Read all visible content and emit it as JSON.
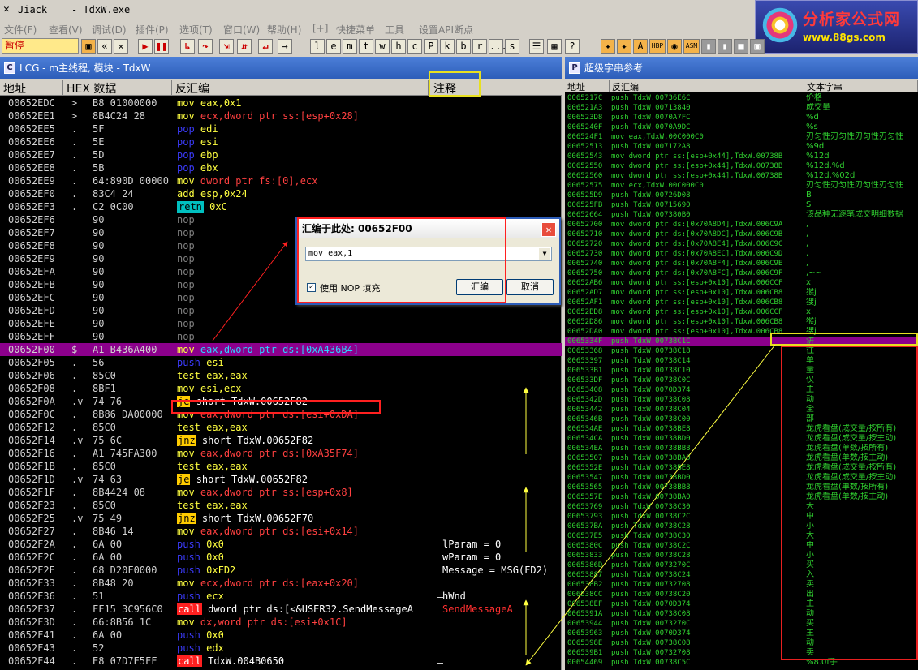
{
  "window": {
    "title_app": "Jiack",
    "title_exe": "- TdxW.exe"
  },
  "logo": {
    "line1": "分析家公式网",
    "line2": "www.88gs.com"
  },
  "menu": [
    "文件(F)",
    "查看(V)",
    "调试(D)",
    "插件(P)",
    "选项(T)",
    "窗口(W)",
    "帮助(H)",
    "[+]",
    "快捷菜单",
    "工具",
    "设置API断点"
  ],
  "toolbar": {
    "status": "暂停",
    "letters": [
      "l",
      "e",
      "m",
      "t",
      "w",
      "h",
      "c",
      "P",
      "k",
      "b",
      "r",
      "...",
      "s"
    ],
    "hbp": "HBP",
    "asm": "ASM"
  },
  "left_pane": {
    "title": "LCG - m主线程, 模块 - TdxW",
    "headers": {
      "addr": "地址",
      "hex": "HEX 数据",
      "disasm": "反汇编",
      "comment": "注释"
    },
    "rows": [
      {
        "addr": "00652EDC",
        "mark": ">",
        "hex": "B8 01000000",
        "k": "mov",
        "kc": "k-mov",
        "ops": "eax,0x1"
      },
      {
        "addr": "00652EE1",
        "mark": ">",
        "hex": "8B4C24 28",
        "k": "mov",
        "kc": "k-mov",
        "ops": "ecx,dword ptr ss:[esp+0x28]"
      },
      {
        "addr": "00652EE5",
        "mark": ".",
        "hex": "5F",
        "k": "pop",
        "kc": "k-pop",
        "ops": "edi"
      },
      {
        "addr": "00652EE6",
        "mark": ".",
        "hex": "5E",
        "k": "pop",
        "kc": "k-pop",
        "ops": "esi"
      },
      {
        "addr": "00652EE7",
        "mark": ".",
        "hex": "5D",
        "k": "pop",
        "kc": "k-pop",
        "ops": "ebp"
      },
      {
        "addr": "00652EE8",
        "mark": ".",
        "hex": "5B",
        "k": "pop",
        "kc": "k-pop",
        "ops": "ebx"
      },
      {
        "addr": "00652EE9",
        "mark": ".",
        "hex": "64:890D 00000",
        "k": "mov",
        "kc": "k-mov",
        "ops": "dword ptr fs:[0],ecx"
      },
      {
        "addr": "00652EF0",
        "mark": ".",
        "hex": "83C4 24",
        "k": "add",
        "kc": "k-add",
        "ops": "esp,0x24"
      },
      {
        "addr": "00652EF3",
        "mark": ".",
        "hex": "C2 0C00",
        "k": "retn",
        "kc": "k-retn",
        "ops": "0xC"
      },
      {
        "addr": "00652EF6",
        "mark": "",
        "hex": "90",
        "k": "nop",
        "kc": "k-nop",
        "ops": ""
      },
      {
        "addr": "00652EF7",
        "mark": "",
        "hex": "90",
        "k": "nop",
        "kc": "k-nop",
        "ops": ""
      },
      {
        "addr": "00652EF8",
        "mark": "",
        "hex": "90",
        "k": "nop",
        "kc": "k-nop",
        "ops": ""
      },
      {
        "addr": "00652EF9",
        "mark": "",
        "hex": "90",
        "k": "nop",
        "kc": "k-nop",
        "ops": ""
      },
      {
        "addr": "00652EFA",
        "mark": "",
        "hex": "90",
        "k": "nop",
        "kc": "k-nop",
        "ops": ""
      },
      {
        "addr": "00652EFB",
        "mark": "",
        "hex": "90",
        "k": "nop",
        "kc": "k-nop",
        "ops": ""
      },
      {
        "addr": "00652EFC",
        "mark": "",
        "hex": "90",
        "k": "nop",
        "kc": "k-nop",
        "ops": ""
      },
      {
        "addr": "00652EFD",
        "mark": "",
        "hex": "90",
        "k": "nop",
        "kc": "k-nop",
        "ops": ""
      },
      {
        "addr": "00652EFE",
        "mark": "",
        "hex": "90",
        "k": "nop",
        "kc": "k-nop",
        "ops": ""
      },
      {
        "addr": "00652EFF",
        "mark": "",
        "hex": "90",
        "k": "nop",
        "kc": "k-nop",
        "ops": ""
      },
      {
        "addr": "00652F00",
        "mark": "$",
        "hex": "A1 B436A400",
        "k": "mov",
        "kc": "k-mov",
        "ops": "eax,dword ptr ds:[0xA436B4]",
        "sel": true
      },
      {
        "addr": "00652F05",
        "mark": ".",
        "hex": "56",
        "k": "push",
        "kc": "k-push",
        "ops": "esi"
      },
      {
        "addr": "00652F06",
        "mark": ".",
        "hex": "85C0",
        "k": "test",
        "kc": "k-test",
        "ops": "eax,eax"
      },
      {
        "addr": "00652F08",
        "mark": ".",
        "hex": "8BF1",
        "k": "mov",
        "kc": "k-mov",
        "ops": "esi,ecx"
      },
      {
        "addr": "00652F0A",
        "mark": ".v",
        "hex": "74 76",
        "k": "je",
        "kc": "k-jmp",
        "ops": "short TdxW.00652F82"
      },
      {
        "addr": "00652F0C",
        "mark": ".",
        "hex": "8B86 DA00000",
        "k": "mov",
        "kc": "k-mov",
        "ops": "eax,dword ptr ds:[esi+0xDA]"
      },
      {
        "addr": "00652F12",
        "mark": ".",
        "hex": "85C0",
        "k": "test",
        "kc": "k-test",
        "ops": "eax,eax"
      },
      {
        "addr": "00652F14",
        "mark": ".v",
        "hex": "75 6C",
        "k": "jnz",
        "kc": "k-jmp",
        "ops": "short TdxW.00652F82"
      },
      {
        "addr": "00652F16",
        "mark": ".",
        "hex": "A1 745FA300",
        "k": "mov",
        "kc": "k-mov",
        "ops": "eax,dword ptr ds:[0xA35F74]"
      },
      {
        "addr": "00652F1B",
        "mark": ".",
        "hex": "85C0",
        "k": "test",
        "kc": "k-test",
        "ops": "eax,eax"
      },
      {
        "addr": "00652F1D",
        "mark": ".v",
        "hex": "74 63",
        "k": "je",
        "kc": "k-jmp",
        "ops": "short TdxW.00652F82"
      },
      {
        "addr": "00652F1F",
        "mark": ".",
        "hex": "8B4424 08",
        "k": "mov",
        "kc": "k-mov",
        "ops": "eax,dword ptr ss:[esp+0x8]"
      },
      {
        "addr": "00652F23",
        "mark": ".",
        "hex": "85C0",
        "k": "test",
        "kc": "k-test",
        "ops": "eax,eax"
      },
      {
        "addr": "00652F25",
        "mark": ".v",
        "hex": "75 49",
        "k": "jnz",
        "kc": "k-jmp",
        "ops": "short TdxW.00652F70"
      },
      {
        "addr": "00652F27",
        "mark": ".",
        "hex": "8B46 14",
        "k": "mov",
        "kc": "k-mov",
        "ops": "eax,dword ptr ds:[esi+0x14]"
      },
      {
        "addr": "00652F2A",
        "mark": ".",
        "hex": "6A 00",
        "k": "push",
        "kc": "k-push",
        "ops": "0x0",
        "cmt": "lParam = 0"
      },
      {
        "addr": "00652F2C",
        "mark": ".",
        "hex": "6A 00",
        "k": "push",
        "kc": "k-push",
        "ops": "0x0",
        "cmt": "wParam = 0"
      },
      {
        "addr": "00652F2E",
        "mark": ".",
        "hex": "68 D20F0000",
        "k": "push",
        "kc": "k-push",
        "ops": "0xFD2",
        "cmt": "Message = MSG(FD2)"
      },
      {
        "addr": "00652F33",
        "mark": ".",
        "hex": "8B48 20",
        "k": "mov",
        "kc": "k-mov",
        "ops": "ecx,dword ptr ds:[eax+0x20]"
      },
      {
        "addr": "00652F36",
        "mark": ".",
        "hex": "51",
        "k": "push",
        "kc": "k-push",
        "ops": "ecx",
        "cmt": "hWnd"
      },
      {
        "addr": "00652F37",
        "mark": ".",
        "hex": "FF15 3C956C0",
        "k": "call",
        "kc": "k-call",
        "ops": "dword ptr ds:[<&USER32.SendMessageA",
        "cmt": "SendMessageA",
        "cmtc": "#ff3030"
      },
      {
        "addr": "00652F3D",
        "mark": ".",
        "hex": "66:8B56 1C",
        "k": "mov",
        "kc": "k-mov",
        "ops": "dx,word ptr ds:[esi+0x1C]"
      },
      {
        "addr": "00652F41",
        "mark": ".",
        "hex": "6A 00",
        "k": "push",
        "kc": "k-push",
        "ops": "0x0"
      },
      {
        "addr": "00652F43",
        "mark": ".",
        "hex": "52",
        "k": "push",
        "kc": "k-push",
        "ops": "edx"
      },
      {
        "addr": "00652F44",
        "mark": ".",
        "hex": "E8 07D7E5FF",
        "k": "call",
        "kc": "k-call",
        "ops": "TdxW.004B0650"
      }
    ]
  },
  "dialog": {
    "title": "汇编于此处: 00652F00",
    "input_value": "mov eax,1",
    "checkbox_label": "使用 NOP 填充",
    "assemble_label": "汇编",
    "cancel_label": "取消"
  },
  "right_pane": {
    "title": "超级字串参考",
    "headers": {
      "addr": "地址",
      "disasm": "反汇编",
      "text": "文本字串"
    },
    "rows": [
      {
        "a": "0065217C",
        "d": "push TdxW.00736E6C",
        "t": "价格"
      },
      {
        "a": "006521A3",
        "d": "push TdxW.00713840",
        "t": "成交量"
      },
      {
        "a": "006523D8",
        "d": "push TdxW.0070A7FC",
        "t": "%d"
      },
      {
        "a": "0065240F",
        "d": "push TdxW.0070A9DC",
        "t": "%s"
      },
      {
        "a": "006524F1",
        "d": "mov eax,TdxW.00C000C0",
        "t": "刃匀性刃匀性刃匀性刃匀性"
      },
      {
        "a": "00652513",
        "d": "push TdxW.007172A8",
        "t": "%9d"
      },
      {
        "a": "00652543",
        "d": "mov dword ptr ss:[esp+0x44],TdxW.00738B",
        "t": "%12d"
      },
      {
        "a": "00652550",
        "d": "mov dword ptr ss:[esp+0x44],TdxW.00738B",
        "t": "%12d.%d"
      },
      {
        "a": "00652560",
        "d": "mov dword ptr ss:[esp+0x44],TdxW.00738B",
        "t": "%12d.%02d"
      },
      {
        "a": "00652575",
        "d": "mov ecx,TdxW.00C000C0",
        "t": "刃匀性刃匀性刃匀性刃匀性"
      },
      {
        "a": "006525D9",
        "d": "push TdxW.00726D08",
        "t": "B"
      },
      {
        "a": "006525FB",
        "d": "push TdxW.00715690",
        "t": "S"
      },
      {
        "a": "00652664",
        "d": "push TdxW.007380B0",
        "t": "该品种无逐笔成交明细数据"
      },
      {
        "a": "00652700",
        "d": "mov dword ptr ds:[0x70A8D4],TdxW.006C9A",
        "t": ","
      },
      {
        "a": "00652710",
        "d": "mov dword ptr ds:[0x70A8DC],TdxW.006C9B",
        "t": ","
      },
      {
        "a": "00652720",
        "d": "mov dword ptr ds:[0x70A8E4],TdxW.006C9C",
        "t": ","
      },
      {
        "a": "00652730",
        "d": "mov dword ptr ds:[0x70A8EC],TdxW.006C9D",
        "t": ","
      },
      {
        "a": "00652740",
        "d": "mov dword ptr ds:[0x70A8F4],TdxW.006C9E",
        "t": ","
      },
      {
        "a": "00652750",
        "d": "mov dword ptr ds:[0x70A8FC],TdxW.006C9F",
        "t": ",~~"
      },
      {
        "a": "00652AB6",
        "d": "mov dword ptr ss:[esp+0x10],TdxW.006CCF",
        "t": "x"
      },
      {
        "a": "00652AD7",
        "d": "mov dword ptr ss:[esp+0x10],TdxW.006CB8",
        "t": "猴j"
      },
      {
        "a": "00652AF1",
        "d": "mov dword ptr ss:[esp+0x10],TdxW.006CB8",
        "t": "獀j"
      },
      {
        "a": "00652BD8",
        "d": "mov dword ptr ss:[esp+0x10],TdxW.006CCF",
        "t": "x"
      },
      {
        "a": "00652D86",
        "d": "mov dword ptr ss:[esp+0x10],TdxW.006CB8",
        "t": "猴j"
      },
      {
        "a": "00652DA0",
        "d": "mov dword ptr ss:[esp+0x10],TdxW.006CB8",
        "t": "獀j"
      },
      {
        "a": "0065334F",
        "d": "push TdxW.00738C1C",
        "t": "讲",
        "sel": true
      },
      {
        "a": "00653368",
        "d": "push TdxW.00738C18",
        "t": "往"
      },
      {
        "a": "00653397",
        "d": "push TdxW.00738C14",
        "t": "单"
      },
      {
        "a": "006533B1",
        "d": "push TdxW.00738C10",
        "t": "量"
      },
      {
        "a": "006533DF",
        "d": "push TdxW.00738C0C",
        "t": "仅"
      },
      {
        "a": "00653408",
        "d": "push TdxW.0070D374",
        "t": "主"
      },
      {
        "a": "0065342D",
        "d": "push TdxW.00738C08",
        "t": "动"
      },
      {
        "a": "00653442",
        "d": "push TdxW.00738C04",
        "t": "全"
      },
      {
        "a": "0065346B",
        "d": "push TdxW.00738C00",
        "t": "部"
      },
      {
        "a": "006534AE",
        "d": "push TdxW.00738BE8",
        "t": "龙虎看盘(成交量/按所有)"
      },
      {
        "a": "006534CA",
        "d": "push TdxW.00738BD0",
        "t": "龙虎看盘(成交量/按主动)"
      },
      {
        "a": "006534EA",
        "d": "push TdxW.00738BB8",
        "t": "龙虎看盘(单数/按所有)"
      },
      {
        "a": "00653507",
        "d": "push TdxW.00738BA0",
        "t": "龙虎看盘(单数/按主动)"
      },
      {
        "a": "0065352E",
        "d": "push TdxW.00738BE8",
        "t": "龙虎看盘(成交量/按所有)"
      },
      {
        "a": "00653547",
        "d": "push TdxW.00738BD0",
        "t": "龙虎看盘(成交量/按主动)"
      },
      {
        "a": "00653565",
        "d": "push TdxW.00738BB8",
        "t": "龙虎看盘(单数/按所有)"
      },
      {
        "a": "0065357E",
        "d": "push TdxW.00738BA0",
        "t": "龙虎看盘(单数/按主动)"
      },
      {
        "a": "00653769",
        "d": "push TdxW.00738C30",
        "t": "大"
      },
      {
        "a": "00653793",
        "d": "push TdxW.00738C2C",
        "t": "中"
      },
      {
        "a": "006537BA",
        "d": "push TdxW.00738C28",
        "t": "小"
      },
      {
        "a": "006537E5",
        "d": "push TdxW.00738C30",
        "t": "大"
      },
      {
        "a": "0065380C",
        "d": "push TdxW.00738C2C",
        "t": "中"
      },
      {
        "a": "00653833",
        "d": "push TdxW.00738C28",
        "t": "小"
      },
      {
        "a": "0065386D",
        "d": "push TdxW.0073270C",
        "t": "买"
      },
      {
        "a": "00653887",
        "d": "push TdxW.00738C24",
        "t": "入"
      },
      {
        "a": "006538B2",
        "d": "push TdxW.00732708",
        "t": "卖"
      },
      {
        "a": "006538CC",
        "d": "push TdxW.00738C20",
        "t": "出"
      },
      {
        "a": "006538EF",
        "d": "push TdxW.0070D374",
        "t": "主"
      },
      {
        "a": "0065391A",
        "d": "push TdxW.00738C08",
        "t": "动"
      },
      {
        "a": "00653944",
        "d": "push TdxW.0073270C",
        "t": "买"
      },
      {
        "a": "00653963",
        "d": "push TdxW.0070D374",
        "t": "主"
      },
      {
        "a": "0065398E",
        "d": "push TdxW.00738C08",
        "t": "动"
      },
      {
        "a": "006539B1",
        "d": "push TdxW.00732708",
        "t": "卖"
      },
      {
        "a": "00654469",
        "d": "push TdxW.00738C5C",
        "t": "%8.0f手"
      }
    ]
  }
}
